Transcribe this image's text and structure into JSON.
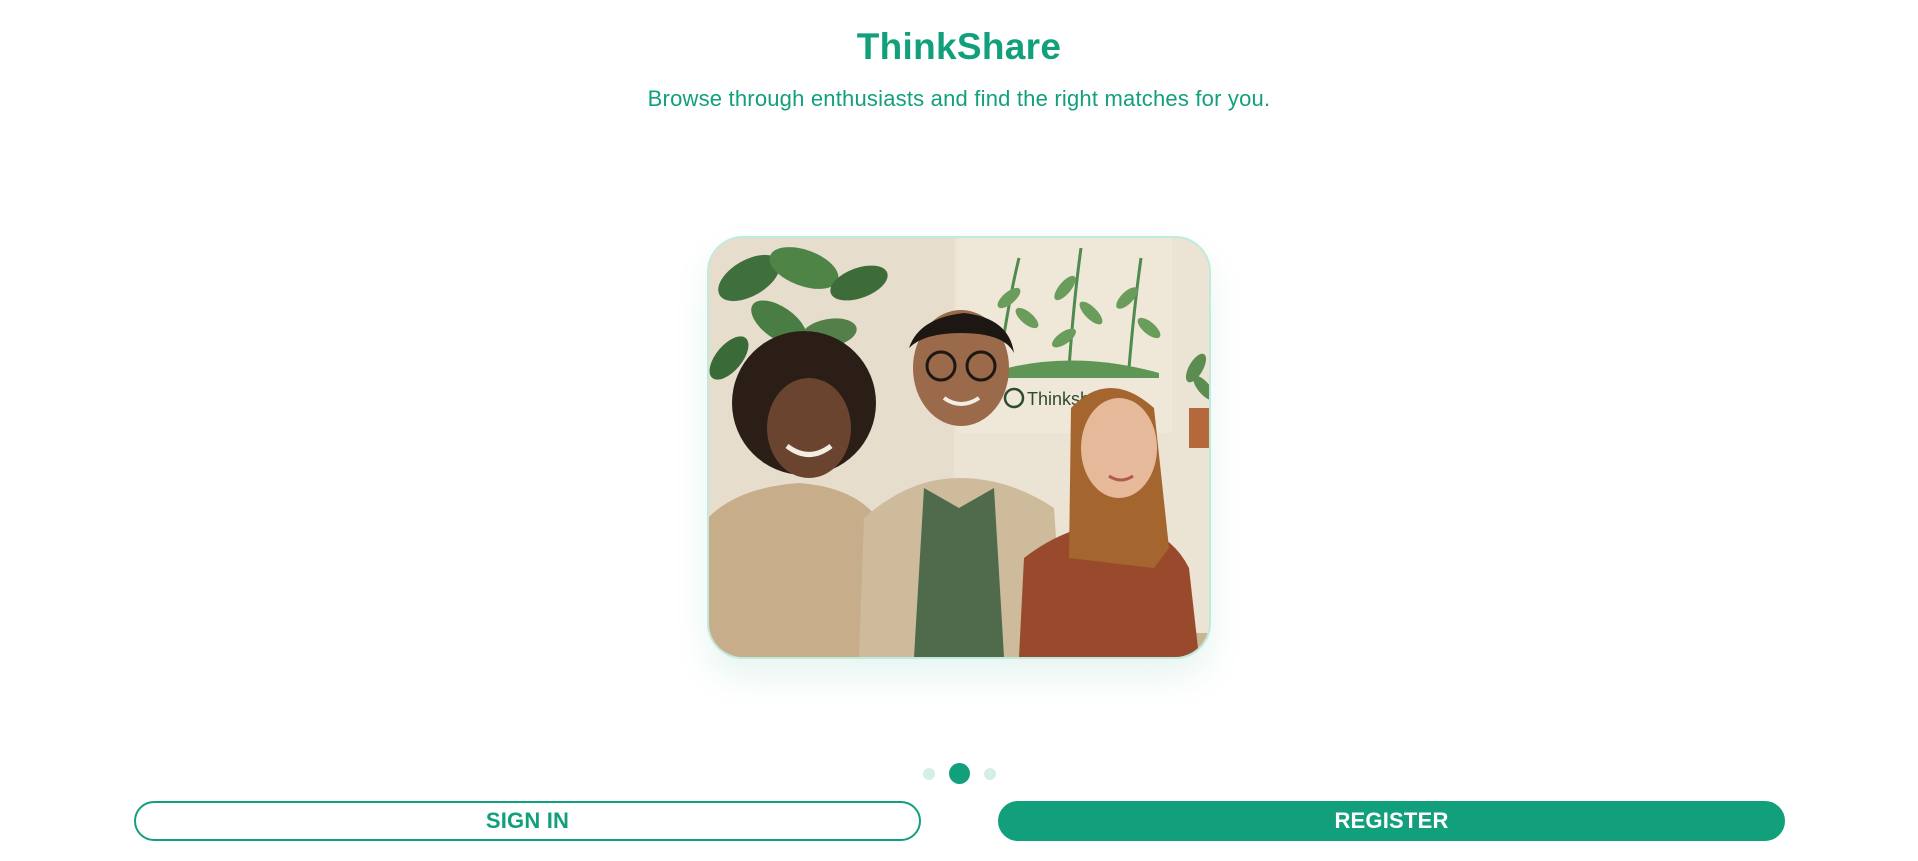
{
  "app": {
    "title": "ThinkShare",
    "subtitle": "Browse through enthusiasts and find the right matches for you."
  },
  "carousel": {
    "slide_count": 3,
    "active_index": 1,
    "image_description": "",
    "image_sign_text": "Thinksh"
  },
  "actions": {
    "sign_in_label": "SIGN IN",
    "register_label": "REGISTER"
  },
  "colors": {
    "accent": "#12a07c",
    "accent_light": "#d4efe6",
    "card_border": "#bfeadc",
    "background": "#ffffff"
  }
}
